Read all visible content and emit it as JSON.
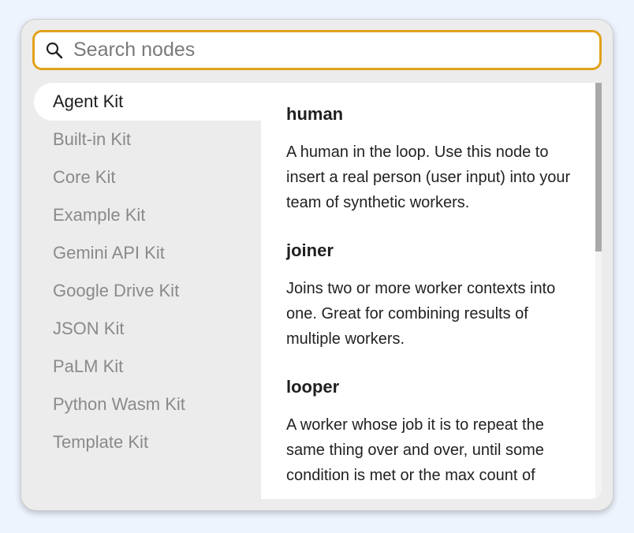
{
  "search": {
    "placeholder": "Search nodes",
    "value": ""
  },
  "kits": [
    {
      "label": "Agent Kit",
      "active": true
    },
    {
      "label": "Built-in Kit",
      "active": false
    },
    {
      "label": "Core Kit",
      "active": false
    },
    {
      "label": "Example Kit",
      "active": false
    },
    {
      "label": "Gemini API Kit",
      "active": false
    },
    {
      "label": "Google Drive Kit",
      "active": false
    },
    {
      "label": "JSON Kit",
      "active": false
    },
    {
      "label": "PaLM Kit",
      "active": false
    },
    {
      "label": "Python Wasm Kit",
      "active": false
    },
    {
      "label": "Template Kit",
      "active": false
    }
  ],
  "nodes": [
    {
      "title": "human",
      "description": "A human in the loop. Use this node to insert a real person (user input) into your team of synthetic workers."
    },
    {
      "title": "joiner",
      "description": "Joins two or more worker contexts into one. Great for combining results of multiple workers."
    },
    {
      "title": "looper",
      "description": "A worker whose job it is to repeat the same thing over and over, until some condition is met or the max count of"
    }
  ],
  "colors": {
    "page_background": "#eef4fe",
    "panel_background": "#ececec",
    "search_border": "#e1a21b",
    "active_kit_text": "#1f1f1f",
    "inactive_kit_text": "#8a8a8a",
    "scroll_thumb": "#a9a9a9"
  },
  "icons": {
    "search": "search-icon"
  }
}
